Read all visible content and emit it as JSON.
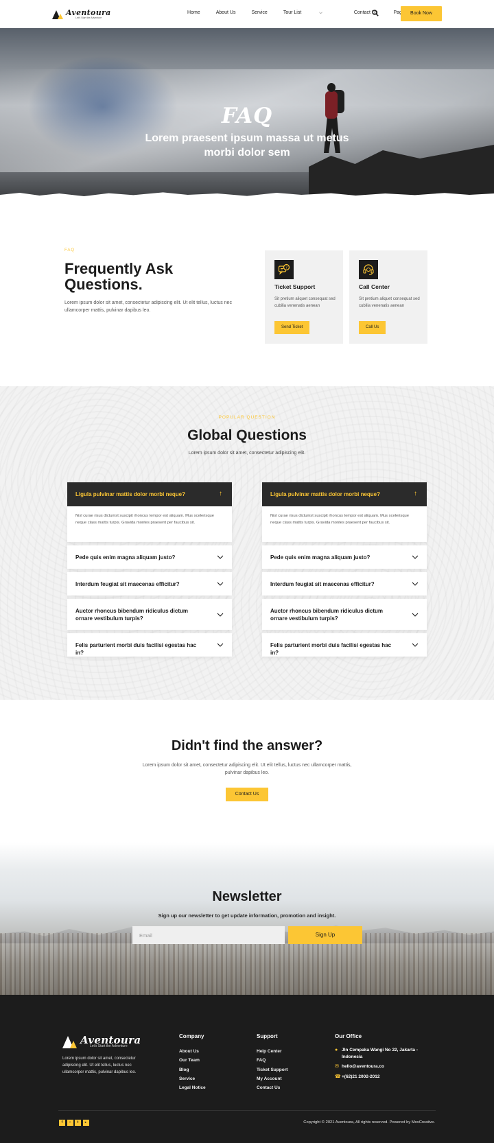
{
  "nav": {
    "logo_text": "Aventoura",
    "logo_tagline": "Let's Start the Adventure",
    "menu": [
      "Home",
      "About Us",
      "Service",
      "Tour List",
      "Contact Us",
      "Page"
    ],
    "book_label": "Book Now"
  },
  "hero": {
    "title": "FAQ",
    "subtitle": "Lorem praesent ipsum massa ut metus morbi dolor sem"
  },
  "faq_intro": {
    "eyebrow": "FAQ",
    "heading": "Frequently Ask Questions.",
    "description": "Lorem ipsum dolor sit amet, consectetur adipiscing elit. Ut elit tellus, luctus nec ullamcorper mattis, pulvinar dapibus leo.",
    "cards": [
      {
        "title": "Ticket Support",
        "text": "Sit pretium aliquet consequat sed cubilia venenatis aenean",
        "button": "Send Ticket",
        "icon": "ticket-support-icon"
      },
      {
        "title": "Call Center",
        "text": "Sit pretium aliquet consequat sed cubilia venenatis aenean",
        "button": "Call Us",
        "icon": "headset-icon"
      }
    ]
  },
  "global": {
    "eyebrow": "POPULAR QUESTION",
    "title": "Global Questions",
    "subtitle": "Lorem ipsum dolor sit amet, consectetur adipiscing elit.",
    "columns": [
      {
        "open_question": "Ligula pulvinar mattis dolor morbi neque?",
        "open_answer": "Nisl curae risus dictumst suscipit rhoncus tempor est aliquam. Mus scelerisque neque class mattis turpis. Gravida montes praesent per faucibus sit.",
        "questions": [
          "Pede quis enim magna aliquam justo?",
          "Interdum feugiat sit maecenas efficitur?",
          "Auctor rhoncus bibendum ridiculus dictum ornare vestibulum turpis?",
          "Felis parturient morbi duis facilisi egestas hac in?"
        ]
      },
      {
        "open_question": "Ligula pulvinar mattis dolor morbi neque?",
        "open_answer": "Nisl curae risus dictumst suscipit rhoncus tempor est aliquam. Mus scelerisque neque class mattis turpis. Gravida montes praesent per faucibus sit.",
        "questions": [
          "Pede quis enim magna aliquam justo?",
          "Interdum feugiat sit maecenas efficitur?",
          "Auctor rhoncus bibendum ridiculus dictum ornare vestibulum turpis?",
          "Felis parturient morbi duis facilisi egestas hac in?"
        ]
      }
    ]
  },
  "cta": {
    "title": "Didn't find the answer?",
    "description": "Lorem ipsum dolor sit amet, consectetur adipiscing elit. Ut elit tellus, luctus nec ullamcorper mattis, pulvinar dapibus leo.",
    "button": "Contact Us"
  },
  "newsletter": {
    "title": "Newsletter",
    "subtitle": "Sign up our newsletter to get update information, promotion and insight.",
    "placeholder": "Email",
    "button": "Sign Up"
  },
  "footer": {
    "logo_text": "Aventoura",
    "logo_tagline": "Let's Start the Adventure",
    "about": "Lorem ipsum dolor sit amet, consectetur adipiscing elit. Ut elit tellus, luctus nec ullamcorper mattis, pulvinar dapibus leo.",
    "company": {
      "heading": "Company",
      "links": [
        "About Us",
        "Our Team",
        "Blog",
        "Service",
        "Legal Notice"
      ]
    },
    "support": {
      "heading": "Support",
      "links": [
        "Help Center",
        "FAQ",
        "Ticket Support",
        "My Account",
        "Contact Us"
      ]
    },
    "office": {
      "heading": "Our Office",
      "address": "Jln Cempaka Wangi No 22, Jakarta - Indonesia",
      "email": "hello@aventoura.co",
      "phone": "+(62)21 2002-2012"
    },
    "socials": [
      "facebook-icon",
      "instagram-icon",
      "twitter-icon",
      "youtube-icon"
    ],
    "copyright": "Copyright © 2021 Aventoura, All rights reserved. Powered by MoxCreative."
  },
  "colors": {
    "accent": "#fcc634",
    "dark": "#1c1c1c",
    "light_bg": "#f2f2f2"
  }
}
